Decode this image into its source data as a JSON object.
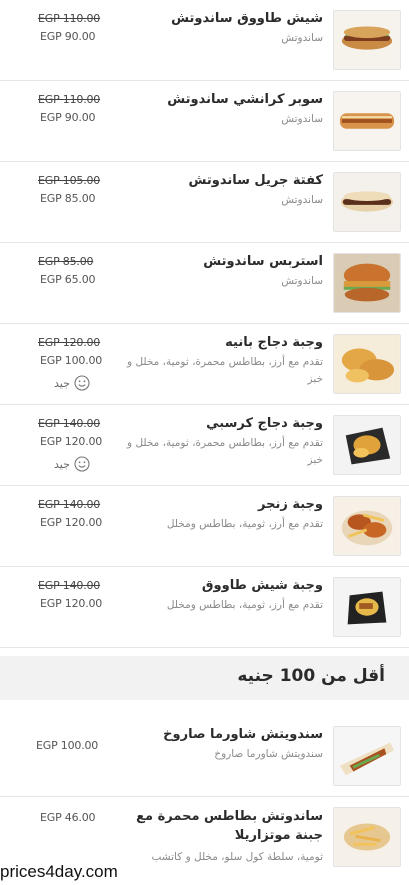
{
  "items": [
    {
      "name": "شيش طاووق ساندوتش",
      "desc": "ساندوتش",
      "old_price": "EGP 110.00",
      "price": "EGP 90.00",
      "image": "shish-sandwich"
    },
    {
      "name": "سوبر كرانشي ساندوتش",
      "desc": "ساندوتش",
      "old_price": "EGP 110.00",
      "price": "EGP 90.00",
      "image": "crunchy-sandwich"
    },
    {
      "name": "كفتة جريل ساندوتش",
      "desc": "ساندوتش",
      "old_price": "EGP 105.00",
      "price": "EGP 85.00",
      "image": "kofta-sandwich"
    },
    {
      "name": "استربس ساندوتش",
      "desc": "ساندوتش",
      "old_price": "EGP 85.00",
      "price": "EGP 65.00",
      "image": "strips-burger"
    },
    {
      "name": "وجبة دجاج بانيه",
      "desc": "تقدم مع أرز، بطاطس محمرة، ثومية، مخلل و خبز",
      "old_price": "EGP 120.00",
      "price": "EGP 100.00",
      "rating": "جيد",
      "image": "pane-meal"
    },
    {
      "name": "وجبة دجاج كرسبي",
      "desc": "تقدم مع أرز، بطاطس محمرة، ثومية، مخلل و خبز",
      "old_price": "EGP 140.00",
      "price": "EGP 120.00",
      "rating": "جيد",
      "image": "crispy-meal"
    },
    {
      "name": "وجبة زنجر",
      "desc": "تقدم مع أرز، ثومية، بطاطس ومخلل",
      "old_price": "EGP 140.00",
      "price": "EGP 120.00",
      "image": "zinger-meal"
    },
    {
      "name": "وجبة شيش طاووق",
      "desc": "تقدم مع أرز، ثومية، بطاطس ومخلل",
      "old_price": "EGP 140.00",
      "price": "EGP 120.00",
      "image": "shish-meal"
    }
  ],
  "section": {
    "title": "أقل من 100 جنيه"
  },
  "section_items": [
    {
      "name": "سندويتش شاورما صاروخ",
      "desc": "سندويتش شاورما صاروخ",
      "price": "EGP 100.00",
      "image": "shawarma-wrap"
    },
    {
      "name": "ساندوتش بطاطس محمرة مع جبنة موتزاريلا",
      "desc": "ثومية، سلطة كول سلو، مخلل و كاتشب",
      "price": "EGP 46.00",
      "image": "fries-sandwich"
    }
  ],
  "watermark": "prices4day.com",
  "colors": {
    "bread": "#c98a44",
    "filling": "#7a3b1e",
    "lettuce": "#6aa84f",
    "fried": "#d99a3a",
    "box": "#2a2a2a"
  }
}
